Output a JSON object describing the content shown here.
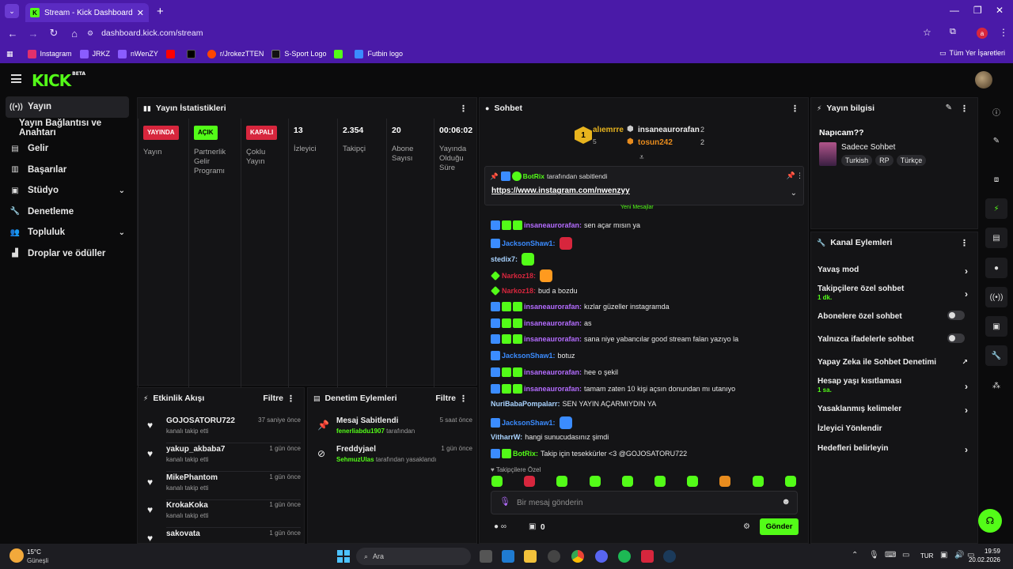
{
  "browser": {
    "tab_title": "Stream - Kick Dashboard",
    "url_host": "dashboard.kick.com/stream",
    "profile_initial": "a",
    "bookmarks": [
      "Instagram",
      "JRKZ",
      "nWenZY",
      "",
      "",
      "r/JrokezTTEN",
      "S-Sport Logo",
      "",
      "Futbin logo"
    ],
    "all_bookmarks": "Tüm Yer İşaretleri"
  },
  "app": {
    "logo": "KICK",
    "logo_beta": "BETA",
    "sidebar": [
      {
        "label": "Yayın",
        "icon": "broadcast-icon",
        "active": true
      },
      {
        "label": "Yayın Bağlantısı ve Anahtarı",
        "sub": true
      },
      {
        "label": "Gelir",
        "icon": "revenue-icon"
      },
      {
        "label": "Başarılar",
        "icon": "achievements-icon"
      },
      {
        "label": "Stüdyo",
        "icon": "studio-icon",
        "chevron": true
      },
      {
        "label": "Denetleme",
        "icon": "wrench-icon"
      },
      {
        "label": "Topluluk",
        "icon": "community-icon",
        "chevron": true
      },
      {
        "label": "Droplar ve ödüller",
        "icon": "gift-icon"
      }
    ]
  },
  "stats": {
    "title": "Yayın İstatistikleri",
    "columns": [
      {
        "badge": "YAYINDA",
        "badge_color": "#d7263d",
        "label": "Yayın"
      },
      {
        "badge": "AÇIK",
        "badge_color": "#53fc18",
        "label": "Partnerlik Gelir Programı"
      },
      {
        "badge": "KAPALI",
        "badge_color": "#d7263d",
        "label": "Çoklu Yayın"
      },
      {
        "value": "13",
        "label": "İzleyici"
      },
      {
        "value": "2.354",
        "label": "Takipçi"
      },
      {
        "value": "20",
        "label": "Abone Sayısı"
      },
      {
        "value": "00:06:02",
        "label": "Yayında Olduğu Süre"
      }
    ]
  },
  "activity": {
    "title": "Etkinlik Akışı",
    "filter": "Filtre",
    "items": [
      {
        "name": "GOJOSATORU722",
        "sub": "kanalı takip etti",
        "time": "37 saniye önce"
      },
      {
        "name": "yakup_akbaba7",
        "sub": "kanalı takip etti",
        "time": "1 gün önce"
      },
      {
        "name": "MikePhantom",
        "sub": "kanalı takip etti",
        "time": "1 gün önce"
      },
      {
        "name": "KrokaKoka",
        "sub": "kanalı takip etti",
        "time": "1 gün önce"
      },
      {
        "name": "sakovata",
        "sub": "",
        "time": "1 gün önce"
      }
    ]
  },
  "moderation": {
    "title": "Denetim Eylemleri",
    "filter": "Filtre",
    "items": [
      {
        "name": "Mesaj Sabitlendi",
        "actor": "fenerliabdu1907",
        "suffix": "tarafından",
        "time": "5 saat önce"
      },
      {
        "name": "Freddyjael",
        "actor": "SehmuzUlas",
        "suffix": "tarafından yasaklandı",
        "time": "1 gün önce"
      }
    ]
  },
  "chat": {
    "title": "Sohbet",
    "leaderboard": [
      {
        "rank": "1",
        "name": "alıemrre",
        "count": "5"
      },
      {
        "name": "insaneaurorafan",
        "count": "2"
      },
      {
        "name": "tosun242",
        "count": "2"
      }
    ],
    "pinned": {
      "by": "BotRix",
      "suffix": "tarafından sabitlendi",
      "link": "https://www.instagram.com/nwenzyy"
    },
    "partial_label": "Yeni Mesajlar",
    "messages": [
      {
        "user": "insaneaurorafan",
        "color": "#b46cff",
        "text": "sen açar mısın ya"
      },
      {
        "user": "JacksonShaw1",
        "color": "#3b8cff",
        "text": "",
        "emote": "#d7263d"
      },
      {
        "user": "stedix7",
        "color": "#a9d3ff",
        "text": "",
        "emote": "#53fc18"
      },
      {
        "user": "Narkoz18",
        "color": "#d7263d",
        "text": "",
        "emote": "#ff9a1f"
      },
      {
        "user": "Narkoz18",
        "color": "#d7263d",
        "text": "bud a bozdu"
      },
      {
        "user": "insaneaurorafan",
        "color": "#b46cff",
        "text": "kızlar güzeller instagramda"
      },
      {
        "user": "insaneaurorafan",
        "color": "#b46cff",
        "text": "as"
      },
      {
        "user": "insaneaurorafan",
        "color": "#b46cff",
        "text": "sana niye yabancılar good stream falan yazıyo la"
      },
      {
        "user": "JacksonShaw1",
        "color": "#3b8cff",
        "text": "botuz"
      },
      {
        "user": "insaneaurorafan",
        "color": "#b46cff",
        "text": "hee o şekil"
      },
      {
        "user": "insaneaurorafan",
        "color": "#b46cff",
        "text": "tamam zaten 10 kişi açsın donundan mı utanıyo"
      },
      {
        "user": "NuriBabaPompalarr",
        "color": "#a9d3ff",
        "text": "SEN YAYIN AÇARMIYDIN YA"
      },
      {
        "user": "JacksonShaw1",
        "color": "#3b8cff",
        "text": "",
        "emote": "#3b8cff"
      },
      {
        "user": "VitharrW",
        "color": "#a9d3ff",
        "text": "hangi sunucudasınız şimdi"
      },
      {
        "user": "BotRix",
        "color": "#53fc18",
        "text": "Takip için tesekkürler <3 @GOJOSATORU722"
      }
    ],
    "follower_only": "Takipçilere Özel",
    "input_placeholder": "Bir mesaj gönderin",
    "kicks": "0",
    "send": "Gönder"
  },
  "stream_info": {
    "title": "Yayın bilgisi",
    "stream_title": "Napıcam??",
    "category": "Sadece Sohbet",
    "tags": [
      "Turkish",
      "RP",
      "Türkçe"
    ]
  },
  "channel_actions": {
    "title": "Kanal Eylemleri",
    "items": [
      {
        "label": "Yavaş mod",
        "kind": "arrow"
      },
      {
        "label": "Takipçilere özel sohbet",
        "sub": "1 dk.",
        "kind": "arrow"
      },
      {
        "label": "Abonelere özel sohbet",
        "kind": "toggle"
      },
      {
        "label": "Yalnızca ifadelerle sohbet",
        "kind": "toggle"
      },
      {
        "label": "Yapay Zeka ile Sohbet Denetimi",
        "kind": "ext"
      },
      {
        "label": "Hesap yaşı kısıtlaması",
        "sub": "1 sa.",
        "kind": "arrow"
      },
      {
        "label": "Yasaklanmış kelimeler",
        "kind": "arrow"
      },
      {
        "label": "İzleyici Yönlendir",
        "kind": "none"
      },
      {
        "label": "Hedefleri belirleyin",
        "kind": "arrow"
      }
    ]
  },
  "taskbar": {
    "weather_temp": "15°C",
    "weather_label": "Güneşli",
    "search": "Ara",
    "lang": "TUR",
    "time": "19:59",
    "date": "20.02.2026"
  },
  "colors": {
    "accent": "#53fc18",
    "chrome": "#4a1aa8",
    "panel": "#141416"
  }
}
